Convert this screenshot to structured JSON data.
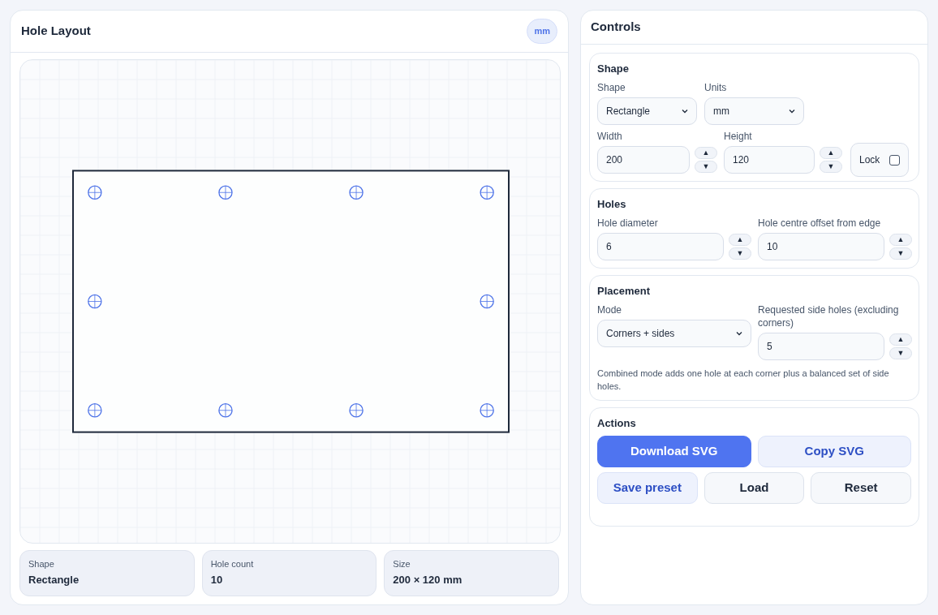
{
  "layout_panel": {
    "title": "Hole Layout",
    "unit_badge": "mm"
  },
  "summary": [
    {
      "label": "Shape",
      "value": "Rectangle"
    },
    {
      "label": "Hole count",
      "value": "10"
    },
    {
      "label": "Size",
      "value": "200 × 120 mm"
    }
  ],
  "controls": {
    "title": "Controls",
    "shape_section": {
      "title": "Shape",
      "shape": {
        "label": "Shape",
        "value": "Rectangle"
      },
      "units": {
        "label": "Units",
        "value": "mm"
      },
      "width": {
        "label": "Width",
        "value": "200",
        "up": "▲",
        "down": "▼"
      },
      "height": {
        "label": "Height",
        "value": "120",
        "up": "▲",
        "down": "▼"
      },
      "lock": {
        "label": "Lock",
        "checked": false
      }
    },
    "holes_section": {
      "title": "Holes",
      "diameter": {
        "label": "Hole diameter",
        "value": "6",
        "up": "▲",
        "down": "▼"
      },
      "offset": {
        "label": "Hole centre offset from edge",
        "value": "10",
        "up": "▲",
        "down": "▼"
      }
    },
    "placement_section": {
      "title": "Placement",
      "mode": {
        "label": "Mode",
        "value": "Corners + sides"
      },
      "side_holes": {
        "label": "Requested side holes (excluding corners)",
        "value": "5",
        "up": "▲",
        "down": "▼"
      },
      "note": "Combined mode adds one hole at each corner plus a balanced set of side holes."
    },
    "actions_section": {
      "title": "Actions",
      "buttons": [
        {
          "label": "Download SVG",
          "kind": "primary"
        },
        {
          "label": "Copy SVG",
          "kind": "secondary"
        },
        {
          "label": "Save preset",
          "kind": "secondary"
        },
        {
          "label": "Load",
          "kind": "plain"
        },
        {
          "label": "Reset",
          "kind": "plain"
        }
      ]
    }
  }
}
